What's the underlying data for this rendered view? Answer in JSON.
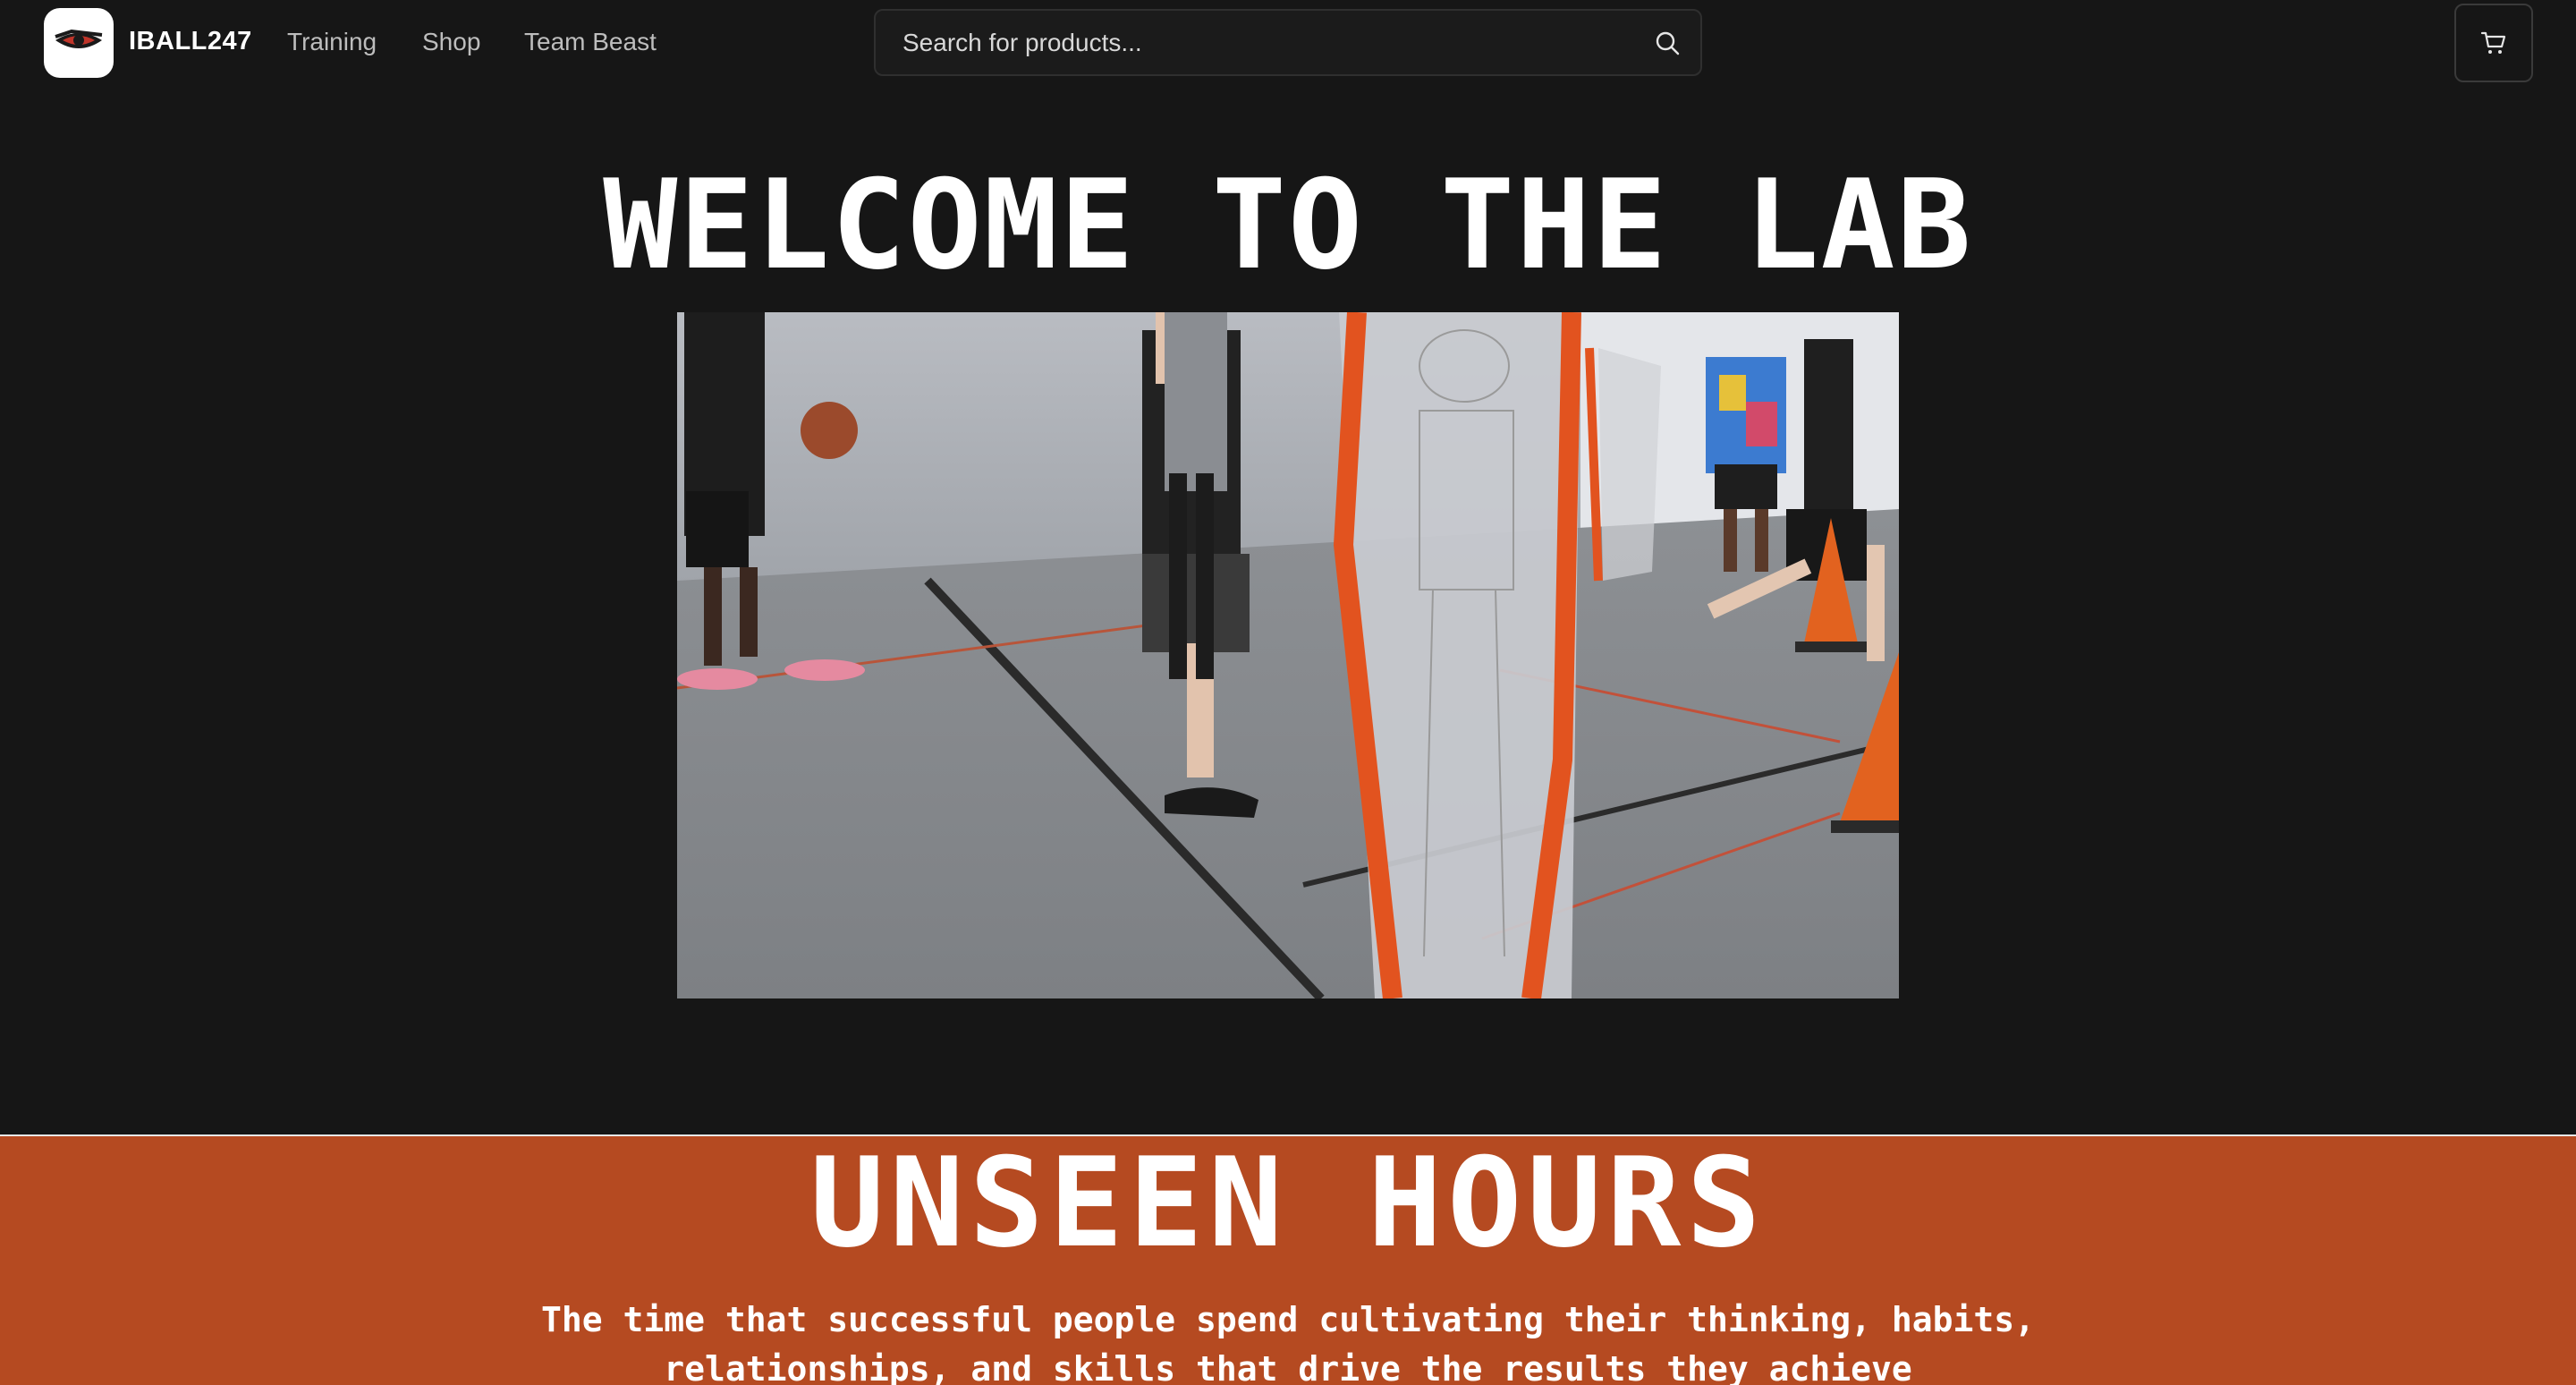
{
  "nav": {
    "brand": "IBALL247",
    "links": [
      {
        "label": "Training"
      },
      {
        "label": "Shop"
      },
      {
        "label": "Team Beast"
      }
    ],
    "search": {
      "placeholder": "Search for products..."
    },
    "icons": {
      "logo": "eye-logo-icon",
      "search": "search-icon",
      "cart": "cart-icon"
    }
  },
  "hero": {
    "title": "WELCOME TO THE LAB",
    "video_description_icon": "training-video"
  },
  "banner": {
    "title": "UNSEEN HOURS",
    "body": "The time that successful people spend cultivating their thinking, habits, relationships, and skills that drive the results they achieve"
  },
  "colors": {
    "background": "#161616",
    "accent": "#b54a21",
    "text": "#ffffff",
    "nav_link": "#bdbdbd"
  }
}
